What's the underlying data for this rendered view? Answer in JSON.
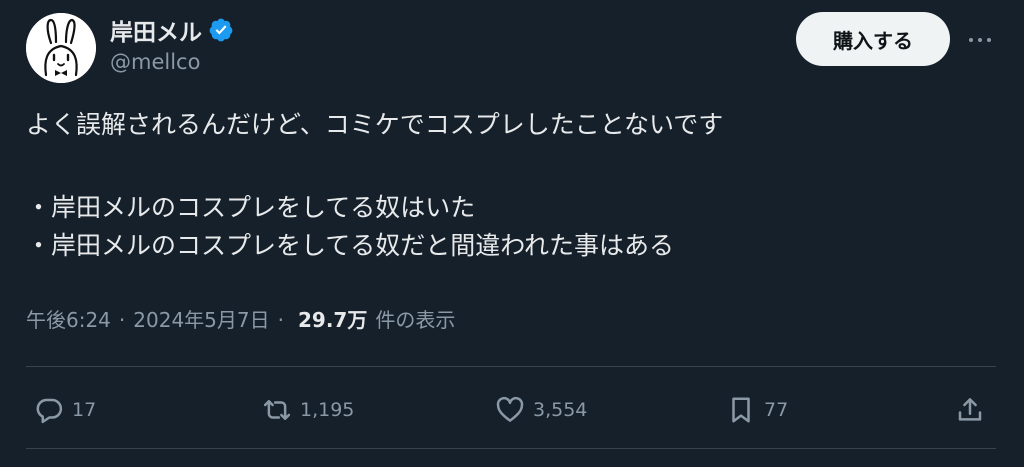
{
  "author": {
    "display_name": "岸田メル",
    "handle": "@mellco",
    "verified": true,
    "avatar_icon": "rabbit-avatar"
  },
  "header": {
    "subscribe_label": "購入する",
    "more_icon": "more-icon"
  },
  "tweet": {
    "lines": [
      "よく誤解されるんだけど、コミケでコスプレしたことないです",
      "・岸田メルのコスプレをしてる奴はいた",
      "・岸田メルのコスプレをしてる奴だと間違われた事はある"
    ]
  },
  "meta": {
    "time": "午後6:24",
    "separator": "·",
    "date": "2024年5月7日",
    "views_count": "29.7万",
    "views_label": "件の表示"
  },
  "actions": {
    "replies": "17",
    "retweets": "1,195",
    "likes": "3,554",
    "bookmarks": "77"
  },
  "colors": {
    "background": "#15202b",
    "text": "#e7e9ea",
    "muted": "#8b98a5",
    "verified": "#1d9bf0",
    "button_bg": "#eff3f4"
  }
}
